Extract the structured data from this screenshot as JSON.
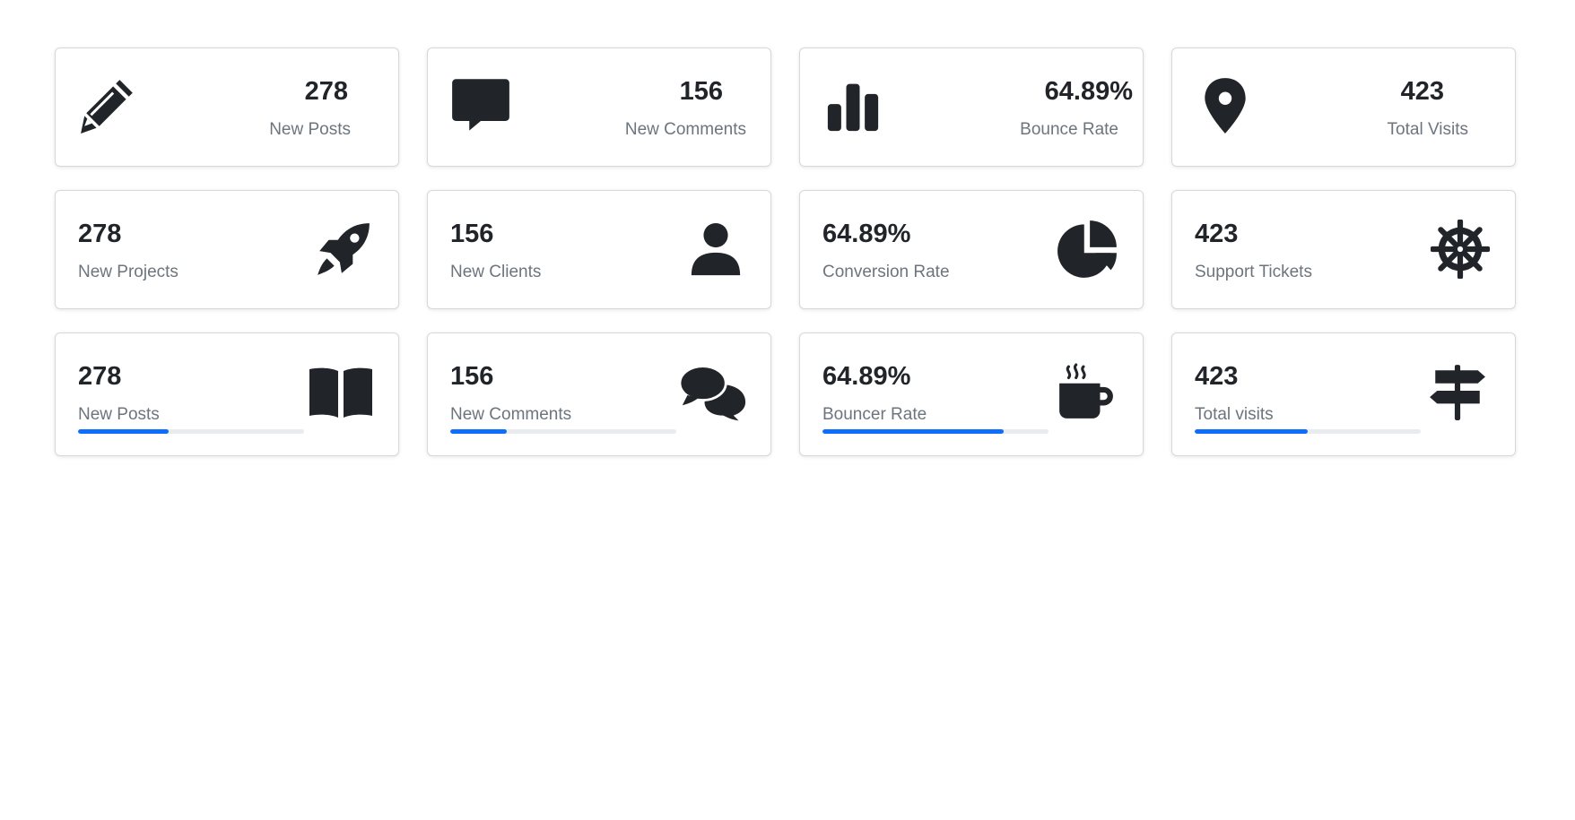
{
  "row1": [
    {
      "value": "278",
      "label": "New Posts",
      "icon": "pencil-icon"
    },
    {
      "value": "156",
      "label": "New Comments",
      "icon": "comment-icon"
    },
    {
      "value": "64.89%",
      "label": "Bounce Rate",
      "icon": "bar-chart-icon"
    },
    {
      "value": "423",
      "label": "Total Visits",
      "icon": "map-pin-icon"
    }
  ],
  "row2": [
    {
      "value": "278",
      "label": "New Projects",
      "icon": "rocket-icon"
    },
    {
      "value": "156",
      "label": "New Clients",
      "icon": "user-icon"
    },
    {
      "value": "64.89%",
      "label": "Conversion Rate",
      "icon": "pie-chart-icon"
    },
    {
      "value": "423",
      "label": "Support Tickets",
      "icon": "ship-wheel-icon"
    }
  ],
  "row3": [
    {
      "value": "278",
      "label": "New Posts",
      "icon": "book-open-icon",
      "progress": 0.4
    },
    {
      "value": "156",
      "label": "New Comments",
      "icon": "comments-icon",
      "progress": 0.25
    },
    {
      "value": "64.89%",
      "label": "Bouncer Rate",
      "icon": "coffee-icon",
      "progress": 0.8
    },
    {
      "value": "423",
      "label": "Total visits",
      "icon": "signpost-icon",
      "progress": 0.5
    }
  ],
  "colors": {
    "progress_fill": "#0d6efd",
    "progress_track": "#e9ecef",
    "label": "#6c757d",
    "text": "#212529"
  }
}
